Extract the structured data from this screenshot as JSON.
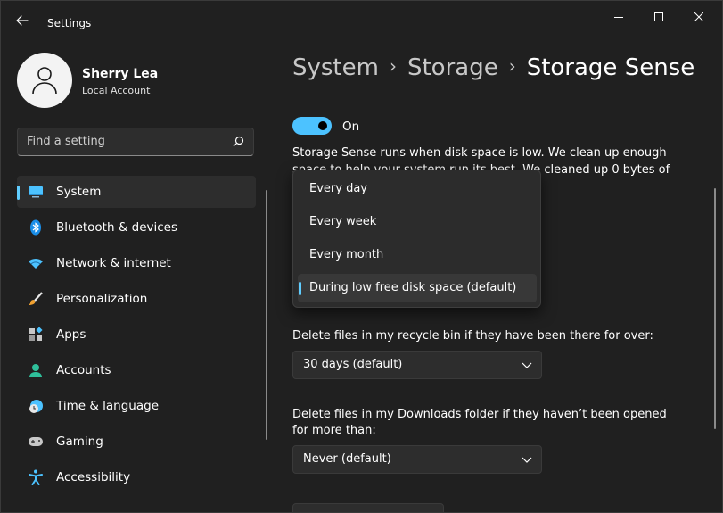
{
  "window": {
    "title": "Settings",
    "minimize_icon": "minimize-icon",
    "maximize_icon": "maximize-icon",
    "close_icon": "close-icon"
  },
  "profile": {
    "name": "Sherry Lea",
    "account_type": "Local Account"
  },
  "search": {
    "placeholder": "Find a setting",
    "value": ""
  },
  "sidebar": {
    "items": [
      {
        "label": "System",
        "icon": "system-icon",
        "active": true
      },
      {
        "label": "Bluetooth & devices",
        "icon": "bluetooth-icon",
        "active": false
      },
      {
        "label": "Network & internet",
        "icon": "wifi-icon",
        "active": false
      },
      {
        "label": "Personalization",
        "icon": "brush-icon",
        "active": false
      },
      {
        "label": "Apps",
        "icon": "apps-icon",
        "active": false
      },
      {
        "label": "Accounts",
        "icon": "accounts-icon",
        "active": false
      },
      {
        "label": "Time & language",
        "icon": "time-language-icon",
        "active": false
      },
      {
        "label": "Gaming",
        "icon": "gamepad-icon",
        "active": false
      },
      {
        "label": "Accessibility",
        "icon": "accessibility-icon",
        "active": false
      }
    ]
  },
  "breadcrumb": {
    "items": [
      "System",
      "Storage",
      "Storage Sense"
    ],
    "separator": "›"
  },
  "storage_sense": {
    "toggle_on": true,
    "toggle_label": "On",
    "description": "Storage Sense runs when disk space is low. We clean up enough space to help your system run its best. We cleaned up 0 bytes of space in the"
  },
  "run_frequency_menu": {
    "options": [
      "Every day",
      "Every week",
      "Every month",
      "During low free disk space (default)"
    ],
    "selected": "During low free disk space (default)"
  },
  "recycle_bin": {
    "label": "Delete files in my recycle bin if they have been there for over:",
    "value": "30 days (default)"
  },
  "downloads": {
    "label": "Delete files in my Downloads folder if they haven’t been opened for more than:",
    "value": "Never (default)"
  },
  "colors": {
    "accent": "#4cc2ff",
    "background": "#202020",
    "surface": "#2d2d2d"
  }
}
